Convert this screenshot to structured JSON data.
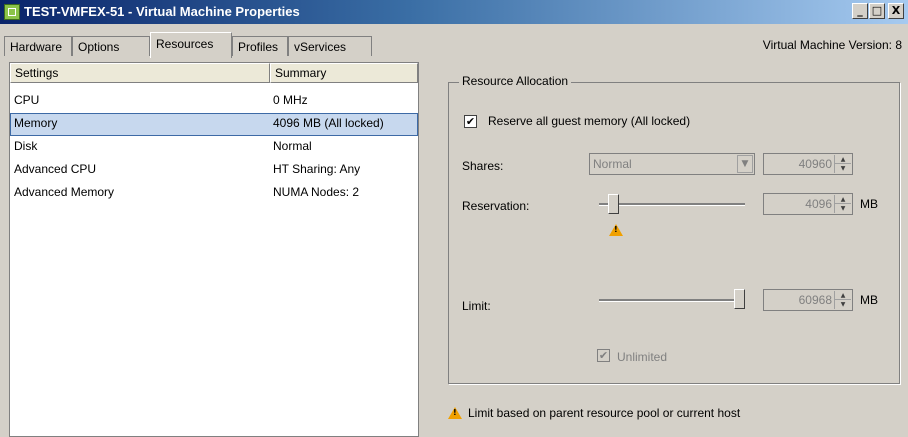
{
  "window": {
    "title": "TEST-VMFEX-51 - Virtual Machine Properties",
    "min_glyph": "_",
    "max_glyph": "□",
    "close_glyph": "X"
  },
  "tabs": [
    {
      "label": "Hardware"
    },
    {
      "label": "Options"
    },
    {
      "label": "Resources"
    },
    {
      "label": "Profiles"
    },
    {
      "label": "vServices"
    }
  ],
  "active_tab": "Resources",
  "vm_version": "Virtual Machine Version: 8",
  "settings_table": {
    "columns": [
      "Settings",
      "Summary"
    ],
    "rows": [
      {
        "setting": "CPU",
        "summary": "0 MHz"
      },
      {
        "setting": "Memory",
        "summary": "4096 MB (All locked)"
      },
      {
        "setting": "Disk",
        "summary": "Normal"
      },
      {
        "setting": "Advanced CPU",
        "summary": "HT Sharing: Any"
      },
      {
        "setting": "Advanced Memory",
        "summary": "NUMA Nodes: 2"
      }
    ],
    "selected": "Memory"
  },
  "resource_allocation": {
    "legend": "Resource Allocation",
    "reserve_all": {
      "label": "Reserve all guest memory (All locked)",
      "checked": true
    },
    "shares": {
      "label": "Shares:",
      "value": "Normal",
      "number": "40960"
    },
    "reservation": {
      "label": "Reservation:",
      "value": "4096",
      "unit": "MB",
      "level": 0.07
    },
    "limit": {
      "label": "Limit:",
      "value": "60968",
      "unit": "MB",
      "level": 1.0
    },
    "unlimited": {
      "label": "Unlimited",
      "checked": true
    }
  },
  "footer_note": "Limit based on parent resource pool or current host",
  "colors": {
    "selection_bg": "#c7d8ee",
    "selection_border": "#3d6aa6",
    "warning": "#f0a000",
    "titlebar_start": "#0a246a"
  }
}
